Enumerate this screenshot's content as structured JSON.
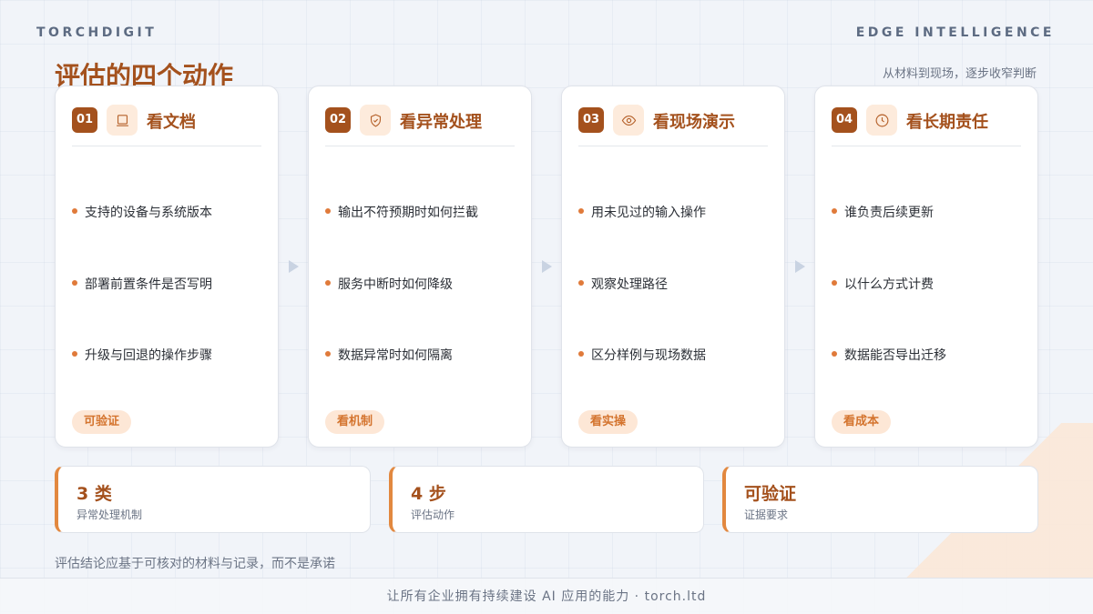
{
  "brand": {
    "left": "TORCHDIGIT",
    "right": "EDGE INTELLIGENCE"
  },
  "header": {
    "title": "评估的四个动作",
    "subtitle": "从材料到现场，逐步收窄判断"
  },
  "cards": [
    {
      "num": "01",
      "icon": "document-icon",
      "title": "看文档",
      "items": [
        "支持的设备与系统版本",
        "部署前置条件是否写明",
        "升级与回退的操作步骤"
      ],
      "tag": "可验证"
    },
    {
      "num": "02",
      "icon": "shield-check-icon",
      "title": "看异常处理",
      "items": [
        "输出不符预期时如何拦截",
        "服务中断时如何降级",
        "数据异常时如何隔离"
      ],
      "tag": "看机制"
    },
    {
      "num": "03",
      "icon": "eye-icon",
      "title": "看现场演示",
      "items": [
        "用未见过的输入操作",
        "观察处理路径",
        "区分样例与现场数据"
      ],
      "tag": "看实操"
    },
    {
      "num": "04",
      "icon": "clock-icon",
      "title": "看长期责任",
      "items": [
        "谁负责后续更新",
        "以什么方式计费",
        "数据能否导出迁移"
      ],
      "tag": "看成本"
    }
  ],
  "stats": [
    {
      "value": "3 类",
      "label": "异常处理机制"
    },
    {
      "value": "4 步",
      "label": "评估动作"
    },
    {
      "value": "可验证",
      "label": "证据要求"
    }
  ],
  "footnote": "评估结论应基于可核对的材料与记录，而不是承诺",
  "footer": "让所有企业拥有持续建设 AI 应用的能力 · torch.ltd",
  "colors": {
    "accent": "#a4511d",
    "accent_light": "#fde7d6",
    "bullet": "#e07a3a"
  }
}
